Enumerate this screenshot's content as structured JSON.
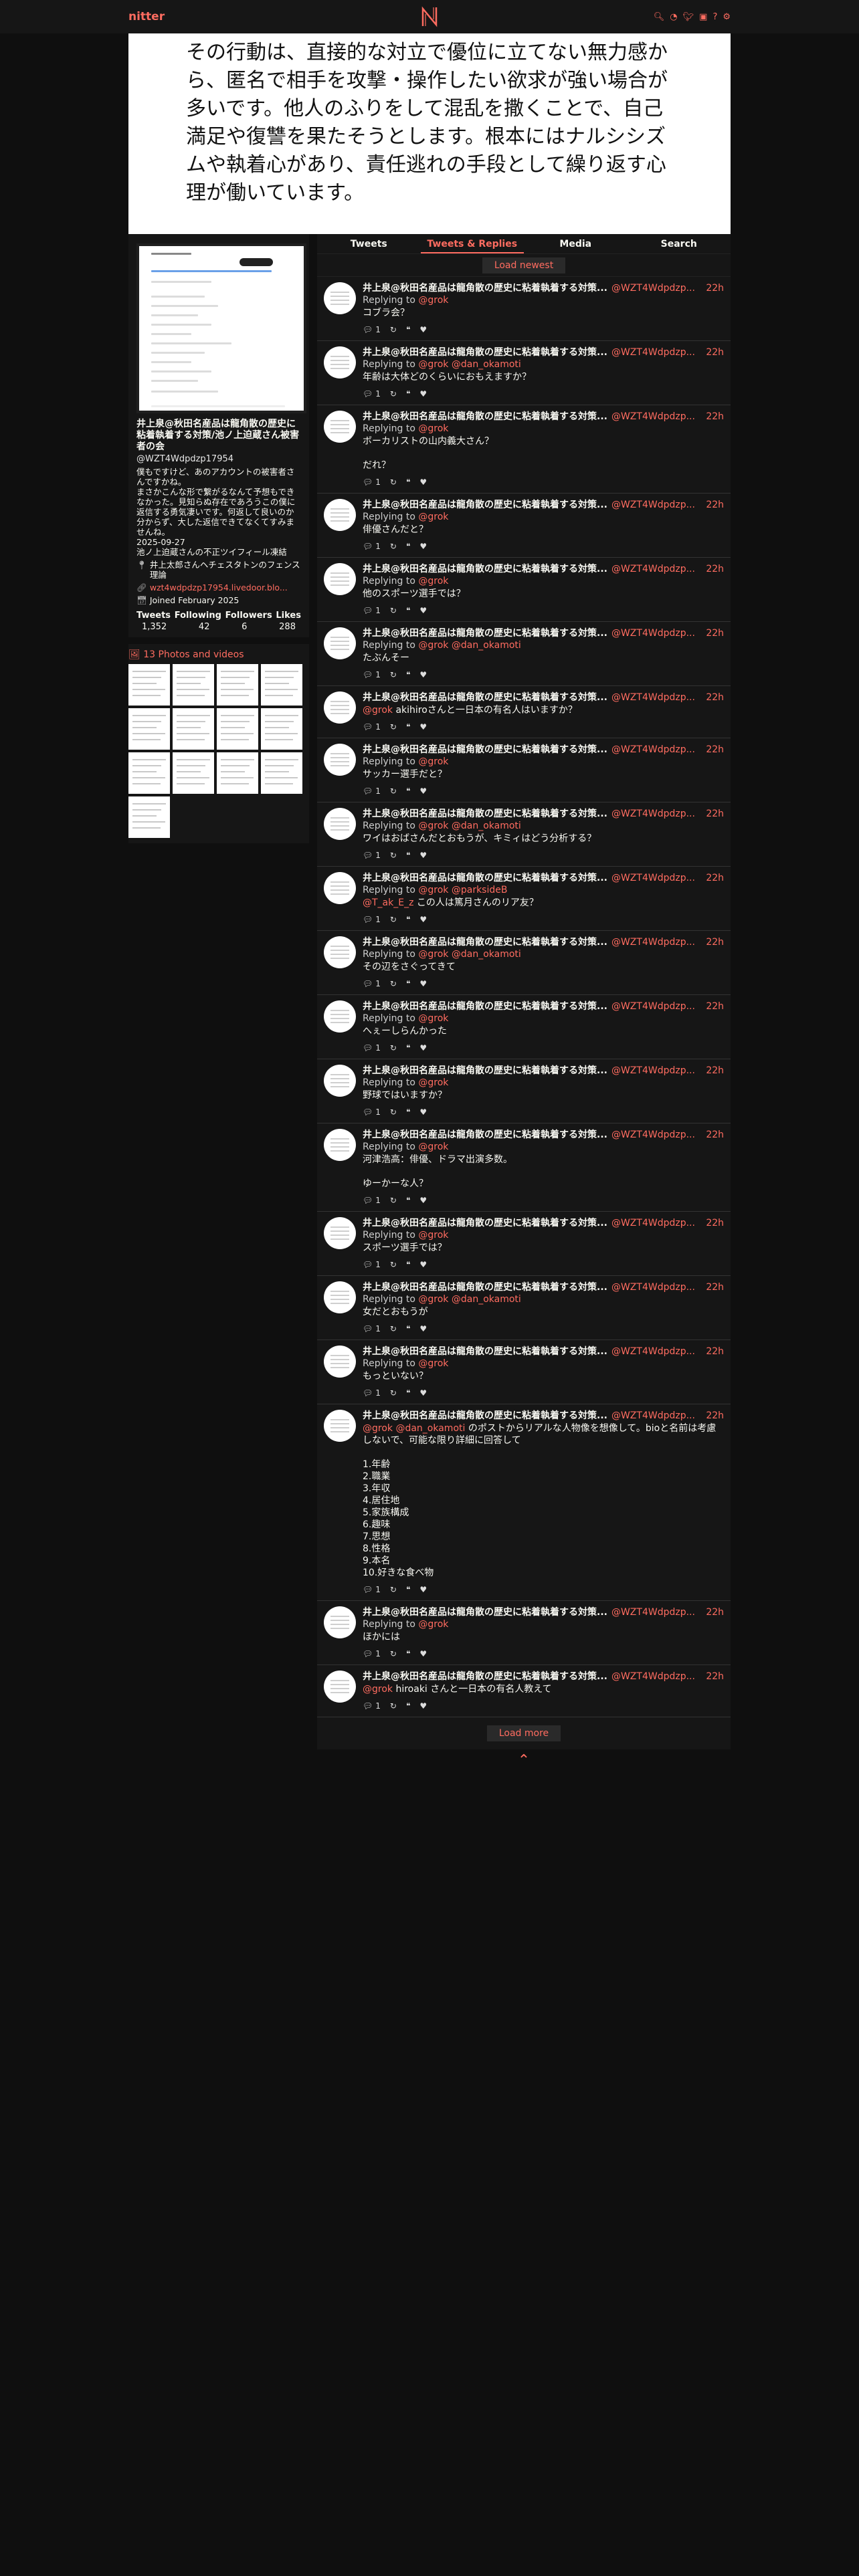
{
  "nav": {
    "brand": "nitter",
    "icons": [
      "search-icon",
      "rss-icon",
      "twitter-icon",
      "nitter-icon",
      "info-icon",
      "gear-icon"
    ]
  },
  "banner": {
    "text": "その行動は、直接的な対立で優位に立てない無力感から、匿名で相手を攻撃・操作したい欲求が強い場合が多いです。他人のふりをして混乱を撒くことで、自己満足や復讐を果たそうとします。根本にはナルシシズムや執着心があり、責任逃れの手段として繰り返す心理が働いています。"
  },
  "profile": {
    "name": "井上泉@秋田名産品は龍角散の歴史に粘着執着する対策/池ノ上迫蔵さん被害者の会",
    "handle": "@WZT4Wdpdzp17954",
    "bio": "僕もですけど、あのアカウントの被害者さんですかね。\nまさかこんな形で繋がるなんて予想もできなかった。見知らぬ存在であろうこの僕に返信する勇気凄いです。何返して良いのか分からず、大した返信できてなくてすみませんね。\n2025-09-27\n池ノ上迫蔵さんの不正ツイフィール凍結",
    "location": "井上太郎さんヘチェスタトンのフェンス理論",
    "website": "wzt4wdpdzp17954.livedoor.blo...",
    "joined": "Joined February 2025",
    "stats": {
      "labels": [
        "Tweets",
        "Following",
        "Followers",
        "Likes"
      ],
      "values": [
        "1,352",
        "42",
        "6",
        "288"
      ]
    }
  },
  "photos": {
    "title": "13 Photos and videos",
    "count": 13
  },
  "tabs": [
    "Tweets",
    "Tweets & Replies",
    "Media",
    "Search"
  ],
  "load_newest": "Load newest",
  "load_more": "Load more",
  "tweets": [
    {
      "name": "井上泉@秋田名産品は龍角散の歴史に粘着執着する対策...",
      "user": "@WZT4Wdpdzp...",
      "time": "22h",
      "reply_prefix": "Replying to",
      "reply": "@grok",
      "content": "コブラ会？",
      "comments": "1"
    },
    {
      "name": "井上泉@秋田名産品は龍角散の歴史に粘着執着する対策...",
      "user": "@WZT4Wdpdzp...",
      "time": "22h",
      "reply_prefix": "Replying to",
      "reply": "@grok @dan_okamoti",
      "content": "年齢は大体どのくらいにおもえますか？",
      "comments": "1"
    },
    {
      "name": "井上泉@秋田名産品は龍角散の歴史に粘着執着する対策...",
      "user": "@WZT4Wdpdzp...",
      "time": "22h",
      "reply_prefix": "Replying to",
      "reply": "@grok",
      "content": "ボーカリストの山内義大さん？\n\nだれ？",
      "comments": "1"
    },
    {
      "name": "井上泉@秋田名産品は龍角散の歴史に粘着執着する対策...",
      "user": "@WZT4Wdpdzp...",
      "time": "22h",
      "reply_prefix": "Replying to",
      "reply": "@grok",
      "content": "俳優さんだと？",
      "comments": "1"
    },
    {
      "name": "井上泉@秋田名産品は龍角散の歴史に粘着執着する対策...",
      "user": "@WZT4Wdpdzp...",
      "time": "22h",
      "reply_prefix": "Replying to",
      "reply": "@grok",
      "content": "他のスポーツ選手では？",
      "comments": "1"
    },
    {
      "name": "井上泉@秋田名産品は龍角散の歴史に粘着執着する対策...",
      "user": "@WZT4Wdpdzp...",
      "time": "22h",
      "reply_prefix": "Replying to",
      "reply": "@grok @dan_okamoti",
      "content": "たぶんそー",
      "comments": "1"
    },
    {
      "name": "井上泉@秋田名産品は龍角散の歴史に粘着執着する対策...",
      "user": "@WZT4Wdpdzp...",
      "time": "22h",
      "reply_prefix": "",
      "reply": "",
      "mention": "@grok",
      "content": " akihiroさんと一日本の有名人はいますか？",
      "comments": "1"
    },
    {
      "name": "井上泉@秋田名産品は龍角散の歴史に粘着執着する対策...",
      "user": "@WZT4Wdpdzp...",
      "time": "22h",
      "reply_prefix": "Replying to",
      "reply": "@grok",
      "content": "サッカー選手だと？",
      "comments": "1"
    },
    {
      "name": "井上泉@秋田名産品は龍角散の歴史に粘着執着する対策...",
      "user": "@WZT4Wdpdzp...",
      "time": "22h",
      "reply_prefix": "Replying to",
      "reply": "@grok @dan_okamoti",
      "content": "ワイはおばさんだとおもうが、キミィはどう分析する？",
      "comments": "1"
    },
    {
      "name": "井上泉@秋田名産品は龍角散の歴史に粘着執着する対策...",
      "user": "@WZT4Wdpdzp...",
      "time": "22h",
      "reply_prefix": "Replying to",
      "reply": "@grok @parksideB",
      "mention": "@T_ak_E_z",
      "content": " この人は篤月さんのリア友？",
      "comments": "1"
    },
    {
      "name": "井上泉@秋田名産品は龍角散の歴史に粘着執着する対策...",
      "user": "@WZT4Wdpdzp...",
      "time": "22h",
      "reply_prefix": "Replying to",
      "reply": "@grok @dan_okamoti",
      "content": "その辺をさぐってきて",
      "comments": "1"
    },
    {
      "name": "井上泉@秋田名産品は龍角散の歴史に粘着執着する対策...",
      "user": "@WZT4Wdpdzp...",
      "time": "22h",
      "reply_prefix": "Replying to",
      "reply": "@grok",
      "content": "へぇーしらんかった",
      "comments": "1"
    },
    {
      "name": "井上泉@秋田名産品は龍角散の歴史に粘着執着する対策...",
      "user": "@WZT4Wdpdzp...",
      "time": "22h",
      "reply_prefix": "Replying to",
      "reply": "@grok",
      "content": "野球ではいますか？",
      "comments": "1"
    },
    {
      "name": "井上泉@秋田名産品は龍角散の歴史に粘着執着する対策...",
      "user": "@WZT4Wdpdzp...",
      "time": "22h",
      "reply_prefix": "Replying to",
      "reply": "@grok",
      "content": "河津浩高：俳優、ドラマ出演多数。\n\nゆーかーな人？",
      "comments": "1"
    },
    {
      "name": "井上泉@秋田名産品は龍角散の歴史に粘着執着する対策...",
      "user": "@WZT4Wdpdzp...",
      "time": "22h",
      "reply_prefix": "Replying to",
      "reply": "@grok",
      "content": "スポーツ選手では？",
      "comments": "1"
    },
    {
      "name": "井上泉@秋田名産品は龍角散の歴史に粘着執着する対策...",
      "user": "@WZT4Wdpdzp...",
      "time": "22h",
      "reply_prefix": "Replying to",
      "reply": "@grok @dan_okamoti",
      "content": "女だとおもうが",
      "comments": "1"
    },
    {
      "name": "井上泉@秋田名産品は龍角散の歴史に粘着執着する対策...",
      "user": "@WZT4Wdpdzp...",
      "time": "22h",
      "reply_prefix": "Replying to",
      "reply": "@grok",
      "content": "もっといない？",
      "comments": "1"
    },
    {
      "name": "井上泉@秋田名産品は龍角散の歴史に粘着執着する対策...",
      "user": "@WZT4Wdpdzp...",
      "time": "22h",
      "reply_prefix": "",
      "reply": "",
      "mention": "@grok @dan_okamoti",
      "content": " のポストからリアルな人物像を想像して。bioと名前は考慮しないで、可能な限り詳細に回答して\n\n1.年齢\n2.職業\n3.年収\n4.居住地\n5.家族構成\n6.趣味\n7.思想\n8.性格\n9.本名\n10.好きな食べ物",
      "comments": "1"
    },
    {
      "name": "井上泉@秋田名産品は龍角散の歴史に粘着執着する対策...",
      "user": "@WZT4Wdpdzp...",
      "time": "22h",
      "reply_prefix": "Replying to",
      "reply": "@grok",
      "content": "ほかには",
      "comments": "1"
    },
    {
      "name": "井上泉@秋田名産品は龍角散の歴史に粘着執着する対策...",
      "user": "@WZT4Wdpdzp...",
      "time": "22h",
      "reply_prefix": "",
      "reply": "",
      "mention": "@grok",
      "content": " hiroaki さんと一日本の有名人教えて",
      "comments": "1"
    }
  ],
  "top_icon": "chevron-up-icon"
}
